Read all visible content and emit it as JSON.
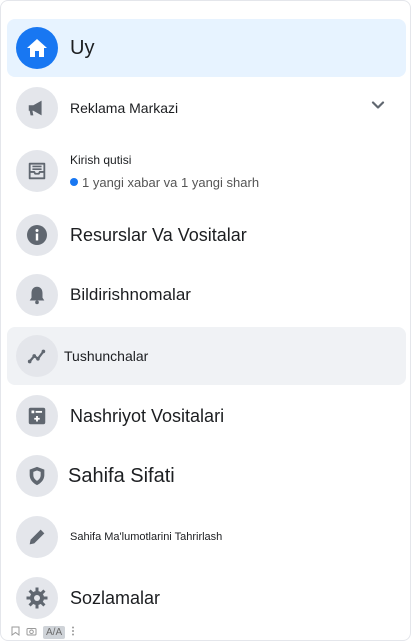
{
  "menu": {
    "home": {
      "label": "Uy",
      "icon": "home-icon"
    },
    "ads": {
      "label": "Reklama Markazi",
      "icon": "megaphone-icon"
    },
    "inbox": {
      "label": "Kirish qutisi",
      "subtitle": "1 yangi xabar va 1 yangi sharh",
      "icon": "inbox-icon"
    },
    "resources": {
      "label": "Resurslar Va Vositalar",
      "icon": "info-icon"
    },
    "notifications": {
      "label": "Bildirishnomalar",
      "icon": "bell-icon"
    },
    "insights": {
      "label": "Tushunchalar",
      "icon": "insights-icon"
    },
    "publishing": {
      "label": "Nashriyot Vositalari",
      "icon": "publishing-tools-icon"
    },
    "quality": {
      "label": "Sahifa Sifati",
      "icon": "shield-icon"
    },
    "edit": {
      "label": "Sahifa Ma'lumotlarini Tahrirlash",
      "icon": "pencil-icon"
    },
    "settings": {
      "label": "Sozlamalar",
      "icon": "gear-icon"
    }
  },
  "colors": {
    "accent": "#1877f2",
    "active_bg": "#e7f3ff",
    "hover_bg": "#f0f2f5",
    "icon_bg": "#e4e6eb",
    "icon_fg": "#606770"
  },
  "bottombar": {
    "items": [
      "bookmark-icon",
      "camera-icon",
      "aa-icon",
      "more-icon"
    ],
    "aa_text": "A/A"
  }
}
